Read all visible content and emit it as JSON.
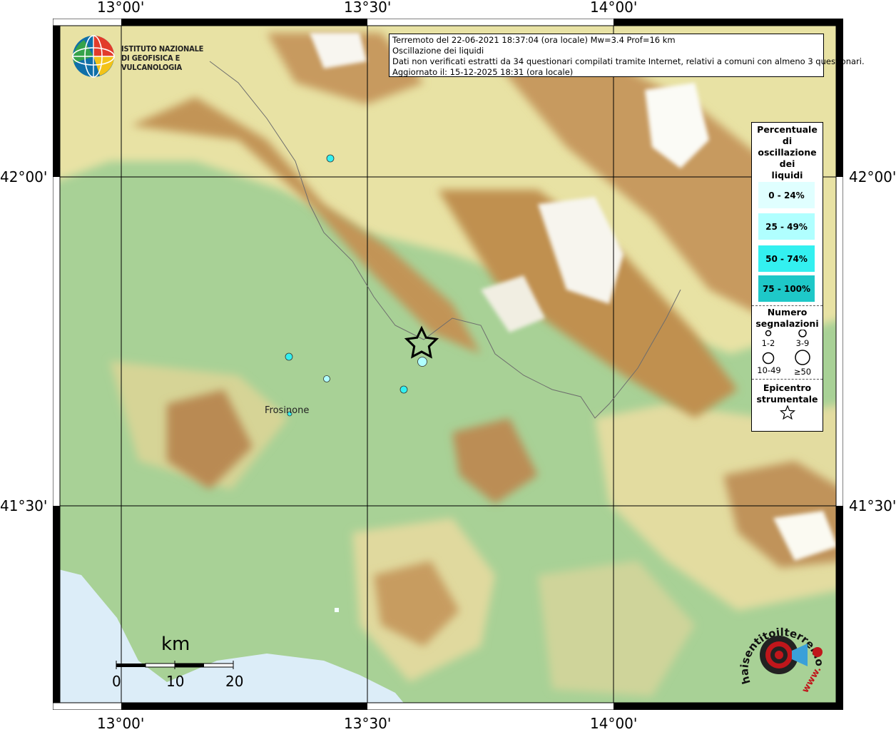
{
  "map": {
    "ticks": {
      "lon_top": [
        "13°00'",
        "13°30'",
        "14°00'"
      ],
      "lon_bottom": [
        "13°00'",
        "13°30'",
        "14°00'"
      ],
      "lat_left": [
        "42°00'",
        "41°30'"
      ],
      "lat_right": [
        "42°00'",
        "41°30'"
      ]
    },
    "info": {
      "line1": "Terremoto del 22-06-2021 18:37:04 (ora locale) Mw=3.4 Prof=16 km",
      "line2": "Oscillazione dei liquidi",
      "line3": "Dati non verificati estratti da 34 questionari compilati tramite Internet, relativi a comuni con almeno 3 questionari.",
      "line4": "Aggiornato il: 15-12-2025 18:31 (ora locale)"
    },
    "logo": {
      "line1": "ISTITUTO NAZIONALE",
      "line2": "DI GEOFISICA E VULCANOLOGIA"
    },
    "city": "Frosinone",
    "scale": {
      "title": "km",
      "labels": [
        "0",
        "10",
        "20"
      ]
    },
    "legend": {
      "title_pct": [
        "Percentuale",
        "di",
        "oscillazione",
        "dei",
        "liquidi"
      ],
      "classes": [
        {
          "label": "0 - 24%",
          "color": "#e0ffff"
        },
        {
          "label": "25 - 49%",
          "color": "#b0ffff"
        },
        {
          "label": "50 - 74%",
          "color": "#33f0f0"
        },
        {
          "label": "75 - 100%",
          "color": "#1ec8c8"
        }
      ],
      "title_count": [
        "Numero",
        "segnalazioni"
      ],
      "counts": [
        "1-2",
        "3-9",
        "10-49",
        "≥50"
      ],
      "title_epi": [
        "Epicentro",
        "strumentale"
      ]
    },
    "hsit": {
      "text": "haisentitoilterremoto.it",
      "www": "www."
    },
    "colors": {
      "sea": "#dbeef9",
      "lowland": "#9fcc8e",
      "hills": "#e6dfa0",
      "mountains": "#b8894d",
      "peaks": "#ffffff"
    }
  }
}
